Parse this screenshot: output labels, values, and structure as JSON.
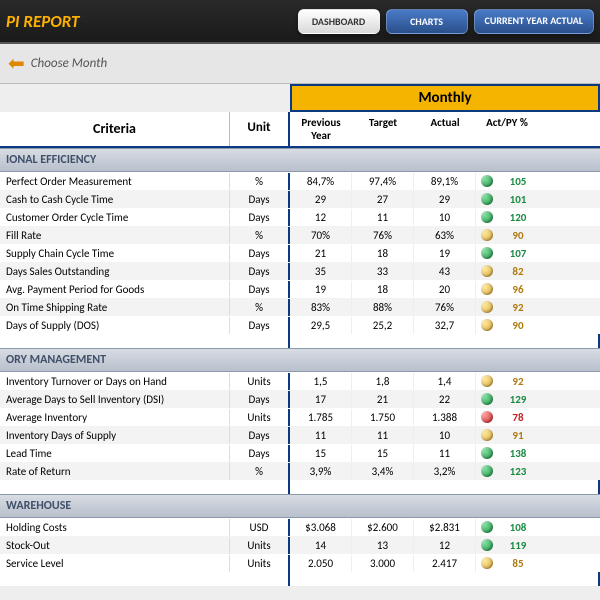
{
  "header": {
    "title": "PI REPORT"
  },
  "nav": {
    "dashboard": "DASHBOARD",
    "charts": "CHARTS",
    "current": "CURRENT YEAR ACTUAL"
  },
  "controls": {
    "choose": "Choose Month",
    "monthly": "Monthly"
  },
  "cols": {
    "criteria": "Criteria",
    "unit": "Unit",
    "prev": "Previous Year",
    "target": "Target",
    "actual": "Actual",
    "actpy": "Act/PY %"
  },
  "sections": [
    {
      "name": "IONAL EFFICIENCY",
      "rows": [
        {
          "cr": "Perfect Order Measurement",
          "un": "%",
          "pv": "84,7%",
          "tg": "97,4%",
          "ac": "89,1%",
          "ind": "g",
          "pct": "105"
        },
        {
          "cr": "Cash to Cash Cycle Time",
          "un": "Days",
          "pv": "29",
          "tg": "27",
          "ac": "29",
          "ind": "g",
          "pct": "101"
        },
        {
          "cr": "Customer Order Cycle Time",
          "un": "Days",
          "pv": "12",
          "tg": "11",
          "ac": "10",
          "ind": "g",
          "pct": "120"
        },
        {
          "cr": "Fill Rate",
          "un": "%",
          "pv": "70%",
          "tg": "76%",
          "ac": "63%",
          "ind": "y",
          "pct": "90"
        },
        {
          "cr": "Supply Chain Cycle Time",
          "un": "Days",
          "pv": "21",
          "tg": "18",
          "ac": "19",
          "ind": "g",
          "pct": "107"
        },
        {
          "cr": "Days Sales Outstanding",
          "un": "Days",
          "pv": "35",
          "tg": "33",
          "ac": "43",
          "ind": "y",
          "pct": "82"
        },
        {
          "cr": "Avg. Payment Period for Goods",
          "un": "Days",
          "pv": "19",
          "tg": "18",
          "ac": "20",
          "ind": "y",
          "pct": "96"
        },
        {
          "cr": "On Time Shipping Rate",
          "un": "%",
          "pv": "83%",
          "tg": "88%",
          "ac": "76%",
          "ind": "y",
          "pct": "92"
        },
        {
          "cr": "Days of Supply (DOS)",
          "un": "Days",
          "pv": "29,5",
          "tg": "25,2",
          "ac": "32,7",
          "ind": "y",
          "pct": "90"
        }
      ]
    },
    {
      "name": "ORY MANAGEMENT",
      "rows": [
        {
          "cr": "Inventory Turnover or Days on Hand",
          "un": "Units",
          "pv": "1,5",
          "tg": "1,8",
          "ac": "1,4",
          "ind": "y",
          "pct": "92"
        },
        {
          "cr": "Average Days to Sell Inventory (DSI)",
          "un": "Days",
          "pv": "17",
          "tg": "21",
          "ac": "22",
          "ind": "g",
          "pct": "129"
        },
        {
          "cr": "Average Inventory",
          "un": "Units",
          "pv": "1.785",
          "tg": "1.750",
          "ac": "1.388",
          "ind": "r",
          "pct": "78"
        },
        {
          "cr": "Inventory Days of Supply",
          "un": "Days",
          "pv": "11",
          "tg": "11",
          "ac": "10",
          "ind": "y",
          "pct": "91"
        },
        {
          "cr": "Lead Time",
          "un": "Days",
          "pv": "15",
          "tg": "15",
          "ac": "11",
          "ind": "g",
          "pct": "138"
        },
        {
          "cr": "Rate of Return",
          "un": "%",
          "pv": "3,9%",
          "tg": "3,4%",
          "ac": "3,2%",
          "ind": "g",
          "pct": "123"
        }
      ]
    },
    {
      "name": "WAREHOUSE",
      "rows": [
        {
          "cr": "Holding Costs",
          "un": "USD",
          "pv": "$3.068",
          "tg": "$2.600",
          "ac": "$2.831",
          "ind": "g",
          "pct": "108"
        },
        {
          "cr": "Stock-Out",
          "un": "Units",
          "pv": "14",
          "tg": "13",
          "ac": "12",
          "ind": "g",
          "pct": "119"
        },
        {
          "cr": "Service Level",
          "un": "Units",
          "pv": "2.050",
          "tg": "3.000",
          "ac": "2.417",
          "ind": "y",
          "pct": "85"
        }
      ]
    }
  ]
}
